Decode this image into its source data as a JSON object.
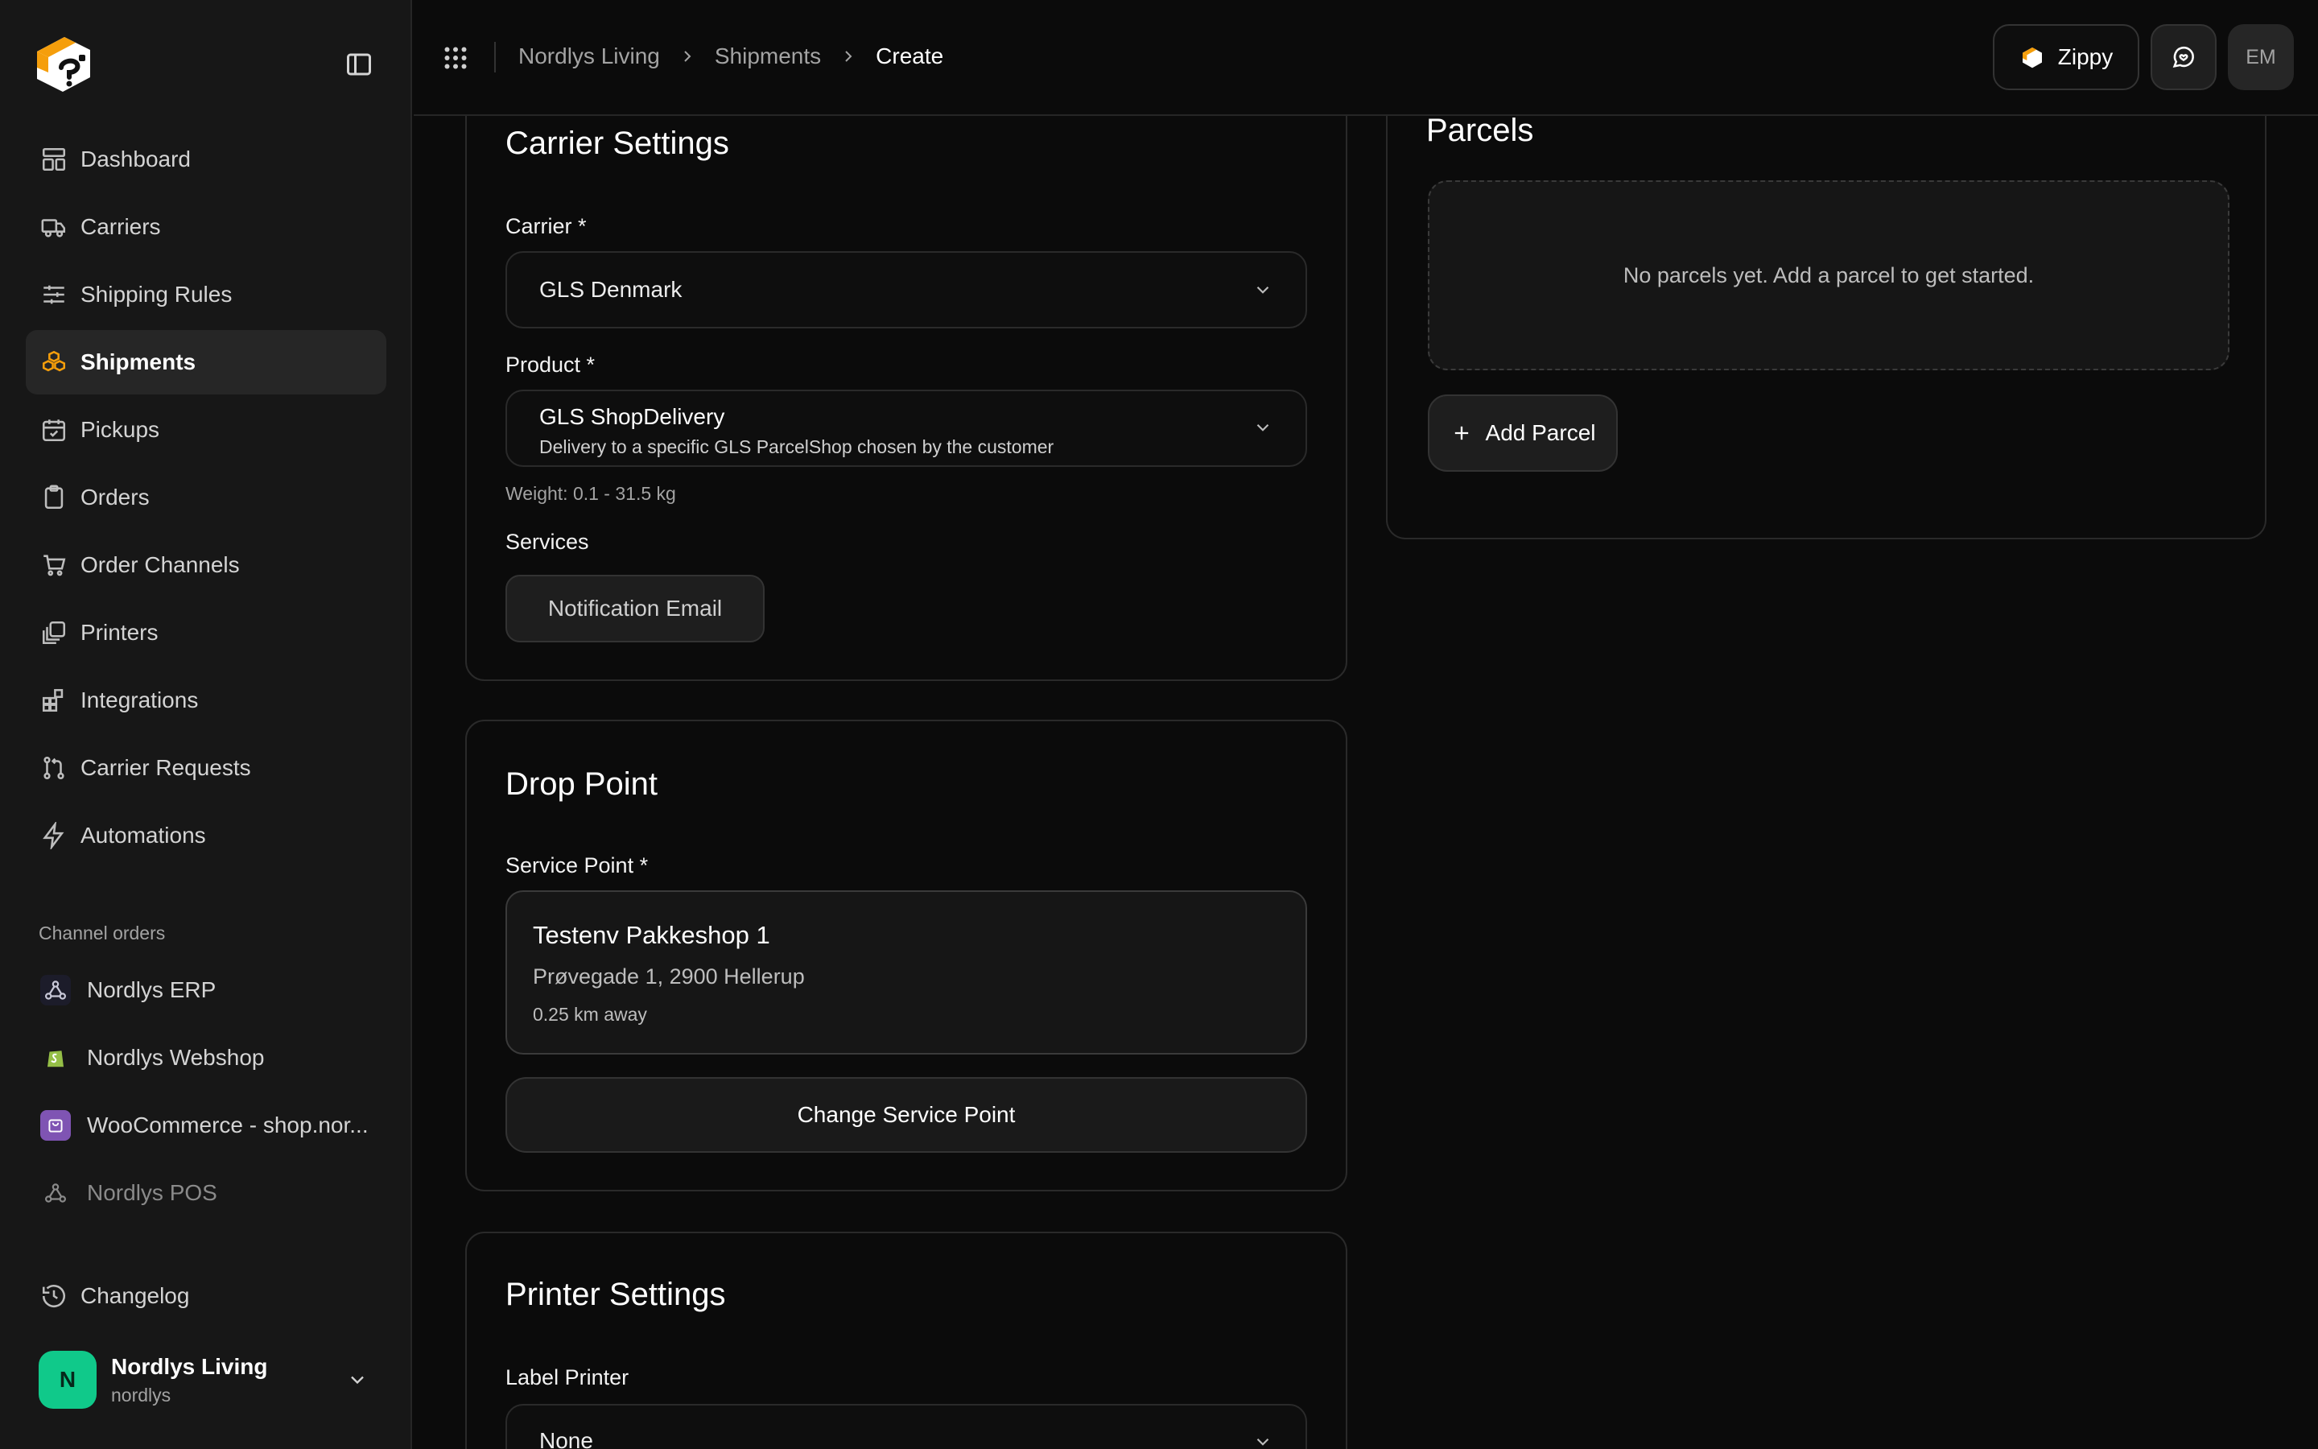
{
  "sidebar": {
    "nav": [
      {
        "label": "Dashboard",
        "icon": "dashboard-icon"
      },
      {
        "label": "Carriers",
        "icon": "truck-icon"
      },
      {
        "label": "Shipping Rules",
        "icon": "sliders-icon"
      },
      {
        "label": "Shipments",
        "icon": "boxes-icon",
        "active": true
      },
      {
        "label": "Pickups",
        "icon": "calendar-check-icon"
      },
      {
        "label": "Orders",
        "icon": "clipboard-icon"
      },
      {
        "label": "Order Channels",
        "icon": "cart-icon"
      },
      {
        "label": "Printers",
        "icon": "printer-icon"
      },
      {
        "label": "Integrations",
        "icon": "integrations-icon"
      },
      {
        "label": "Carrier Requests",
        "icon": "git-pull-request-icon"
      },
      {
        "label": "Automations",
        "icon": "lightning-icon"
      }
    ],
    "channels_label": "Channel orders",
    "channels": [
      {
        "label": "Nordlys ERP",
        "icon": "webhook-icon"
      },
      {
        "label": "Nordlys Webshop",
        "icon": "shopify-icon"
      },
      {
        "label": "WooCommerce - shop.nor...",
        "icon": "woocommerce-icon"
      },
      {
        "label": "Nordlys POS",
        "icon": "webhook-icon"
      }
    ],
    "changelog_label": "Changelog",
    "account": {
      "initial": "N",
      "name": "Nordlys Living",
      "slug": "nordlys"
    }
  },
  "header": {
    "breadcrumb": [
      "Nordlys Living",
      "Shipments",
      "Create"
    ],
    "zippy_label": "Zippy",
    "user_initials": "EM"
  },
  "carrier_settings": {
    "title": "Carrier Settings",
    "carrier_label": "Carrier *",
    "carrier_value": "GLS Denmark",
    "product_label": "Product *",
    "product_value": "GLS ShopDelivery",
    "product_description": "Delivery to a specific GLS ParcelShop chosen by the customer",
    "weight_info": "Weight: 0.1 - 31.5 kg",
    "services_label": "Services",
    "services": [
      "Notification Email"
    ]
  },
  "drop_point": {
    "title": "Drop Point",
    "service_point_label": "Service Point *",
    "point_name": "Testenv Pakkeshop 1",
    "point_address": "Prøvegade 1, 2900 Hellerup",
    "point_distance": "0.25 km away",
    "change_button": "Change Service Point"
  },
  "printer_settings": {
    "title": "Printer Settings",
    "label_printer_label": "Label Printer",
    "label_printer_value": "None"
  },
  "parcels": {
    "title": "Parcels",
    "empty_text": "No parcels yet. Add a parcel to get started.",
    "add_button": "Add Parcel"
  },
  "colors": {
    "accent": "#f59e0b",
    "avatar": "#10c98a",
    "background": "#0b0b0b",
    "sidebar": "#171717"
  }
}
